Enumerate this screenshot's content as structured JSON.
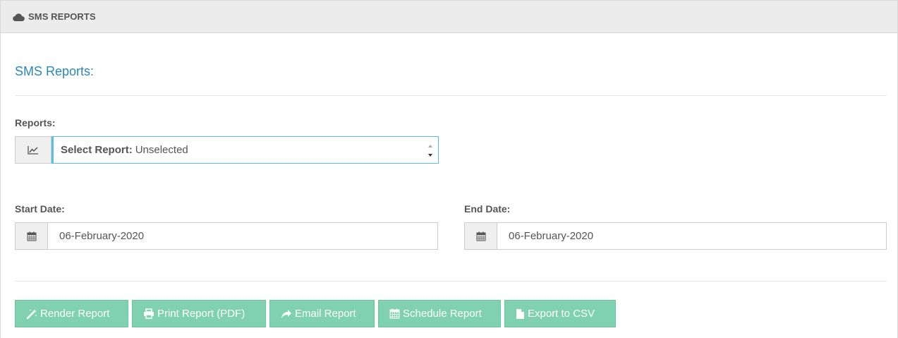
{
  "header": {
    "title": "SMS REPORTS",
    "icon": "cloud-icon"
  },
  "section": {
    "title": "SMS Reports:"
  },
  "reports": {
    "label": "Reports:",
    "select_prefix": "Select Report:",
    "select_value": "Unselected",
    "icon": "line-chart-icon"
  },
  "start_date": {
    "label": "Start Date:",
    "value": "06-February-2020",
    "icon": "calendar-icon"
  },
  "end_date": {
    "label": "End Date:",
    "value": "06-February-2020",
    "icon": "calendar-icon"
  },
  "buttons": {
    "render": "Render Report",
    "print": "Print Report (PDF)",
    "email": "Email Report",
    "schedule": "Schedule Report",
    "export": "Export to CSV"
  },
  "colors": {
    "accent_blue": "#2a87b8",
    "button_green": "#7fd1b2",
    "select_border": "#5bc0de"
  }
}
